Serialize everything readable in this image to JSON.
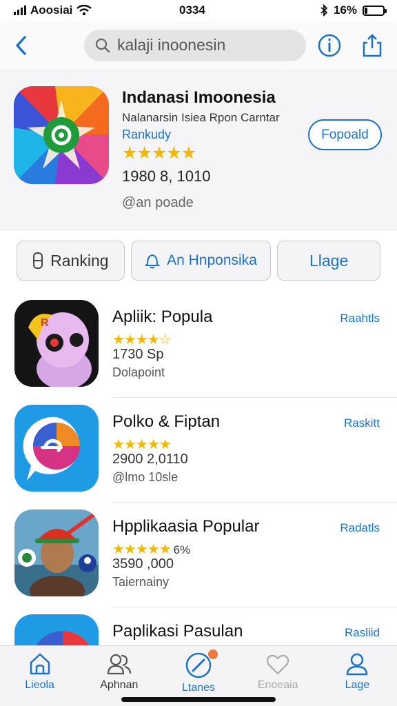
{
  "status": {
    "carrier": "Aoosiai",
    "time": "0334",
    "battery_text": "16%",
    "battery_level": 0.16
  },
  "nav": {
    "search_text": "kalaji inoonesin"
  },
  "featured": {
    "title": "Indanasi Imoonesia",
    "subtitle": "Nalanarsin Isiea Rpon Carntar",
    "category": "Rankudy",
    "rating": 5,
    "rating_count": "1980  8, 1010",
    "note": "@an poade",
    "button_label": "Fopoald"
  },
  "chips": [
    {
      "label": "Ranking",
      "icon": "bookmark-icon"
    },
    {
      "label": "An Hnponsika",
      "icon": "bell-icon"
    },
    {
      "label": "Llage"
    }
  ],
  "apps": [
    {
      "title": "Apliik: Popula",
      "rating": 4.5,
      "stars_text": "★★★★☆",
      "count": "1730 Sp",
      "note": "Dolapoint",
      "action": "Raahtls",
      "icon": "cartoon-creature-icon"
    },
    {
      "title": "Polko & Fiptan",
      "rating": 5,
      "stars_text": "★★★★★",
      "count": "2900 2,0110",
      "note": "@lmo 10sle",
      "action": "Raskitt",
      "icon": "chat-bubble-icon"
    },
    {
      "title": "Hpplikaasia Popular",
      "rating": 5,
      "stars_text": "★★★★★",
      "stars_extra": "6%",
      "count": "3590 ,000",
      "note": "Taiernainy",
      "action": "Radatls",
      "icon": "game-character-icon"
    },
    {
      "title": "Paplikasi Pasulan",
      "action": "Rasliid",
      "icon": "colorful-app-icon"
    }
  ],
  "tabs": [
    {
      "label": "Lieola",
      "icon": "home-icon",
      "active": true
    },
    {
      "label": "Aphnan",
      "icon": "people-icon",
      "active": false
    },
    {
      "label": "Ltanes",
      "icon": "compass-icon",
      "active": true,
      "badge": true
    },
    {
      "label": "Enoeaia",
      "icon": "heart-icon",
      "active": false
    },
    {
      "label": "Lage",
      "icon": "person-icon",
      "active": true
    }
  ],
  "colors": {
    "accent": "#1a73c9",
    "star": "#f2b705",
    "badge": "#f07a3c"
  }
}
